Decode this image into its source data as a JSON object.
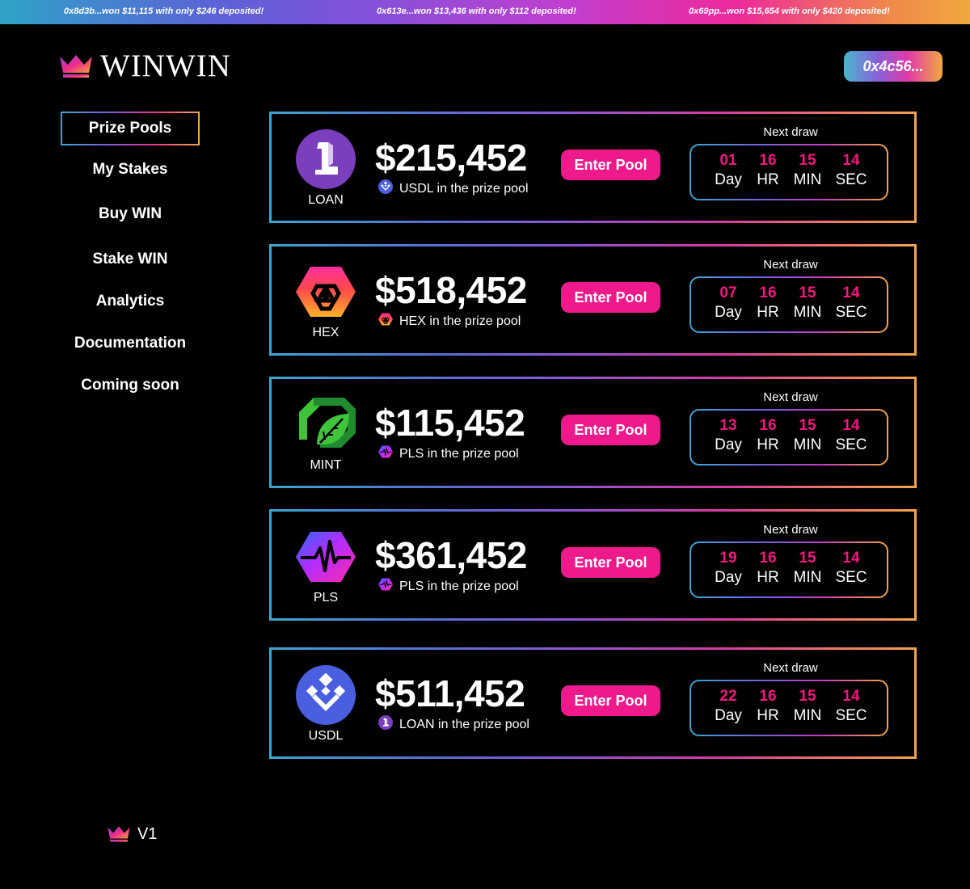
{
  "ticker": [
    "0x8d3b...won $11,115 with only $246 deposited!",
    "0x613e...won $13,436 with only $112 deposited!",
    "0x69pp...won $15,654 with only $420 deposited!"
  ],
  "brand": {
    "name": "WINWIN"
  },
  "wallet": {
    "label": "0x4c56..."
  },
  "nav": {
    "items": [
      "Prize Pools",
      "My Stakes",
      "Buy WIN",
      "Stake WIN",
      "Analytics",
      "Documentation",
      "Coming soon"
    ],
    "active": "Prize Pools"
  },
  "version": "V1",
  "timer_labels": {
    "day": "Day",
    "hr": "HR",
    "min": "MIN",
    "sec": "SEC"
  },
  "next_draw_label": "Next draw",
  "enter_label": "Enter Pool",
  "pools": [
    {
      "token": "LOAN",
      "icon": "loan-icon",
      "amount": "$215,452",
      "prize_text": "USDL in the prize pool",
      "prize_icon": "usdl-icon",
      "timer": {
        "day": "01",
        "hr": "16",
        "min": "15",
        "sec": "14"
      }
    },
    {
      "token": "HEX",
      "icon": "hex-icon",
      "amount": "$518,452",
      "prize_text": "HEX in the prize pool",
      "prize_icon": "hex-icon",
      "timer": {
        "day": "07",
        "hr": "16",
        "min": "15",
        "sec": "14"
      }
    },
    {
      "token": "MINT",
      "icon": "mint-icon",
      "amount": "$115,452",
      "prize_text": "PLS in the prize pool",
      "prize_icon": "pls-icon",
      "timer": {
        "day": "13",
        "hr": "16",
        "min": "15",
        "sec": "14"
      }
    },
    {
      "token": "PLS",
      "icon": "pls-icon",
      "amount": "$361,452",
      "prize_text": "PLS in the prize pool",
      "prize_icon": "pls-icon",
      "timer": {
        "day": "19",
        "hr": "16",
        "min": "15",
        "sec": "14"
      }
    },
    {
      "token": "USDL",
      "icon": "usdl-icon",
      "amount": "$511,452",
      "prize_text": "LOAN in the prize pool",
      "prize_icon": "loan-icon",
      "timer": {
        "day": "22",
        "hr": "16",
        "min": "15",
        "sec": "14"
      }
    }
  ],
  "colors": {
    "accent_pink": "#ee1a8c",
    "timer_number": "#f0197e",
    "loan_purple": "#7b3fbd",
    "usdl_blue": "#4a5fe0",
    "mint_green": "#3ec33a"
  }
}
